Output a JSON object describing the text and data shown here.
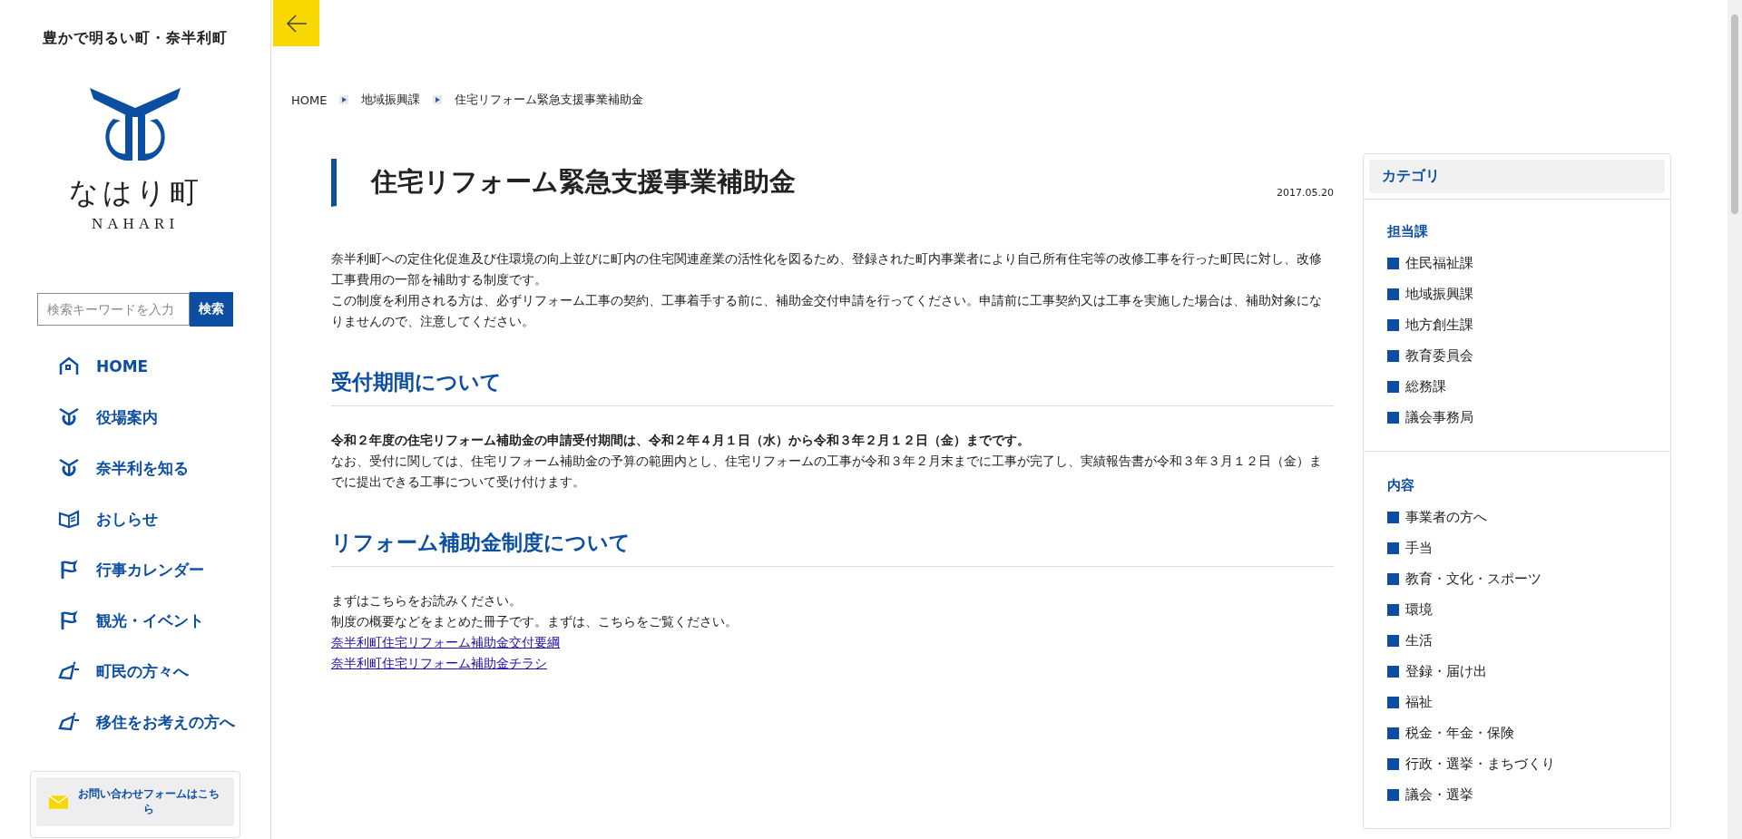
{
  "sidebar": {
    "tagline": "豊かで明るい町・奈半利町",
    "logo_text": "なはり町",
    "logo_roman": "NAHARI",
    "search": {
      "placeholder": "検索キーワードを入力",
      "button": "検索"
    },
    "nav": [
      {
        "label": "HOME",
        "kind": "house"
      },
      {
        "label": "役場案内",
        "kind": "emblem"
      },
      {
        "label": "奈半利を知る",
        "kind": "emblem"
      },
      {
        "label": "おしらせ",
        "kind": "book"
      },
      {
        "label": "行事カレンダー",
        "kind": "flag"
      },
      {
        "label": "観光・イベント",
        "kind": "flag"
      },
      {
        "label": "町民の方々へ",
        "kind": "megaphone"
      },
      {
        "label": "移住をお考えの方へ",
        "kind": "megaphone"
      }
    ],
    "contact": "お問い合わせフォームはこちら"
  },
  "breadcrumb": [
    "HOME",
    "地域振興課",
    "住宅リフォーム緊急支援事業補助金"
  ],
  "article": {
    "title": "住宅リフォーム緊急支援事業補助金",
    "date": "2017.05.20",
    "intro": [
      "奈半利町への定住化促進及び住環境の向上並びに町内の住宅関連産業の活性化を図るため、登録された町内事業者により自己所有住宅等の改修工事を行った町民に対し、改修工事費用の一部を補助する制度です。",
      "この制度を利用される方は、必ずリフォーム工事の契約、工事着手する前に、補助金交付申請を行ってください。申請前に工事契約又は工事を実施した場合は、補助対象になりませんので、注意してください。"
    ],
    "sections": [
      {
        "heading": "受付期間について",
        "lines": [
          {
            "kind": "bold",
            "text": "令和２年度の住宅リフォーム補助金の申請受付期間は、令和２年４月１日（水）から令和３年２月１２日（金）までです。"
          },
          {
            "kind": "plain",
            "text": "なお、受付に関しては、住宅リフォーム補助金の予算の範囲内とし、住宅リフォームの工事が令和３年２月末までに工事が完了し、実績報告書が令和３年３月１２日（金）までに提出できる工事について受け付けます。"
          }
        ]
      },
      {
        "heading": "リフォーム補助金制度について",
        "lines": [
          {
            "kind": "plain",
            "text": "まずはこちらをお読みください。"
          },
          {
            "kind": "plain",
            "text": "制度の概要などをまとめた冊子です。まずは、こちらをご覧ください。"
          },
          {
            "kind": "link",
            "text": "奈半利町住宅リフォーム補助金交付要綱"
          },
          {
            "kind": "link",
            "text": "奈半利町住宅リフォーム補助金チラシ"
          }
        ]
      }
    ]
  },
  "categories": {
    "title": "カテゴリ",
    "groups": [
      {
        "heading": "担当課",
        "items": [
          "住民福祉課",
          "地域振興課",
          "地方創生課",
          "教育委員会",
          "総務課",
          "議会事務局"
        ]
      },
      {
        "heading": "内容",
        "items": [
          "事業者の方へ",
          "手当",
          "教育・文化・スポーツ",
          "環境",
          "生活",
          "登録・届け出",
          "福祉",
          "税金・年金・保険",
          "行政・選挙・まちづくり",
          "議会・選挙"
        ]
      }
    ]
  }
}
